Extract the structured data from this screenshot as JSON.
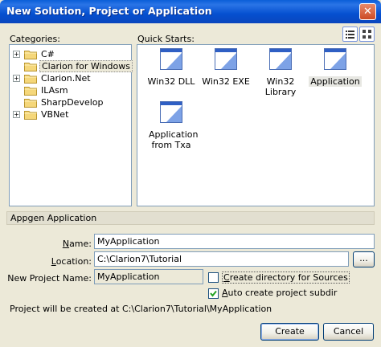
{
  "window": {
    "title": "New Solution, Project or Application",
    "close_glyph": "✕"
  },
  "categories": {
    "label": "Categories:",
    "items": [
      {
        "label": "C#",
        "expandable": true,
        "selected": false
      },
      {
        "label": "Clarion for Windows",
        "expandable": false,
        "selected": true
      },
      {
        "label": "Clarion.Net",
        "expandable": true,
        "selected": false
      },
      {
        "label": "ILAsm",
        "expandable": false,
        "selected": false
      },
      {
        "label": "SharpDevelop",
        "expandable": false,
        "selected": false
      },
      {
        "label": "VBNet",
        "expandable": true,
        "selected": false
      }
    ],
    "expander_glyph": "+"
  },
  "quick_starts": {
    "label": "Quick Starts:",
    "items": [
      {
        "label": "Win32 DLL",
        "selected": false
      },
      {
        "label": "Win32 EXE",
        "selected": false
      },
      {
        "label": "Win32 Library",
        "selected": false
      },
      {
        "label": "Application",
        "selected": true
      },
      {
        "label": "Application from Txa",
        "selected": false
      }
    ]
  },
  "description": "Appgen Application",
  "form": {
    "name_label": "Name:",
    "name_value": "MyApplication",
    "location_label": "Location:",
    "location_value": "C:\\Clarion7\\Tutorial",
    "browse_label": "...",
    "new_project_label": "New Project Name:",
    "new_project_value": "MyApplication",
    "create_dir_label": "Create directory for Sources",
    "create_dir_checked": false,
    "auto_subdir_label": "Auto create project subdir",
    "auto_subdir_checked": true
  },
  "status": "Project will be created at C:\\Clarion7\\Tutorial\\MyApplication",
  "buttons": {
    "create": "Create",
    "cancel": "Cancel"
  },
  "colors": {
    "title_bar": "#0a5fd8",
    "dialog_bg": "#ece9d8",
    "border": "#7f9db9"
  }
}
